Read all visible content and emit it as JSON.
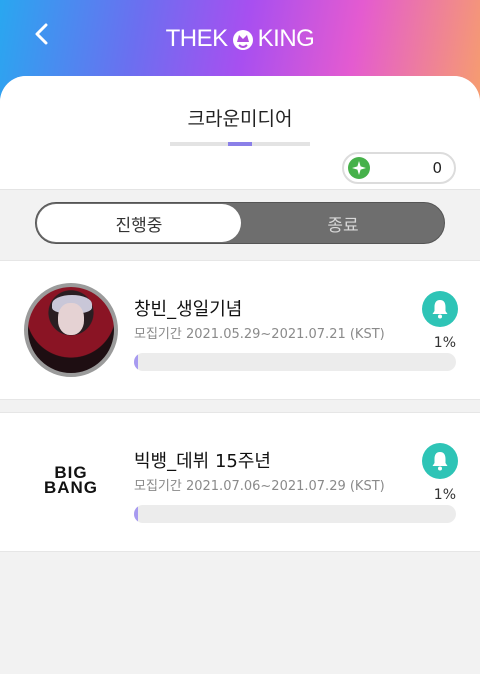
{
  "header": {
    "logo_left": "THEK",
    "logo_right": "KING",
    "back_icon": "chevron-left-icon"
  },
  "agency": {
    "name": "크라운미디어"
  },
  "points": {
    "value": "0",
    "icon": "star-badge-icon",
    "icon_color": "#46b14a"
  },
  "tabs": {
    "active": "진행중",
    "inactive": "종료"
  },
  "events": [
    {
      "title": "창빈_생일기념",
      "period": "모집기간 2021.05.29~2021.07.21 (KST)",
      "percent_label": "1%",
      "progress": 0.01
    },
    {
      "title": "빅뱅_데뷔 15주년",
      "period": "모집기간 2021.07.06~2021.07.29 (KST)",
      "percent_label": "1%",
      "progress": 0.01,
      "logo_text": [
        "BIG",
        "BANG"
      ]
    }
  ],
  "colors": {
    "accent": "#8a7fe8",
    "bell": "#2ec4b6",
    "progress_fill": "#a79af0"
  }
}
